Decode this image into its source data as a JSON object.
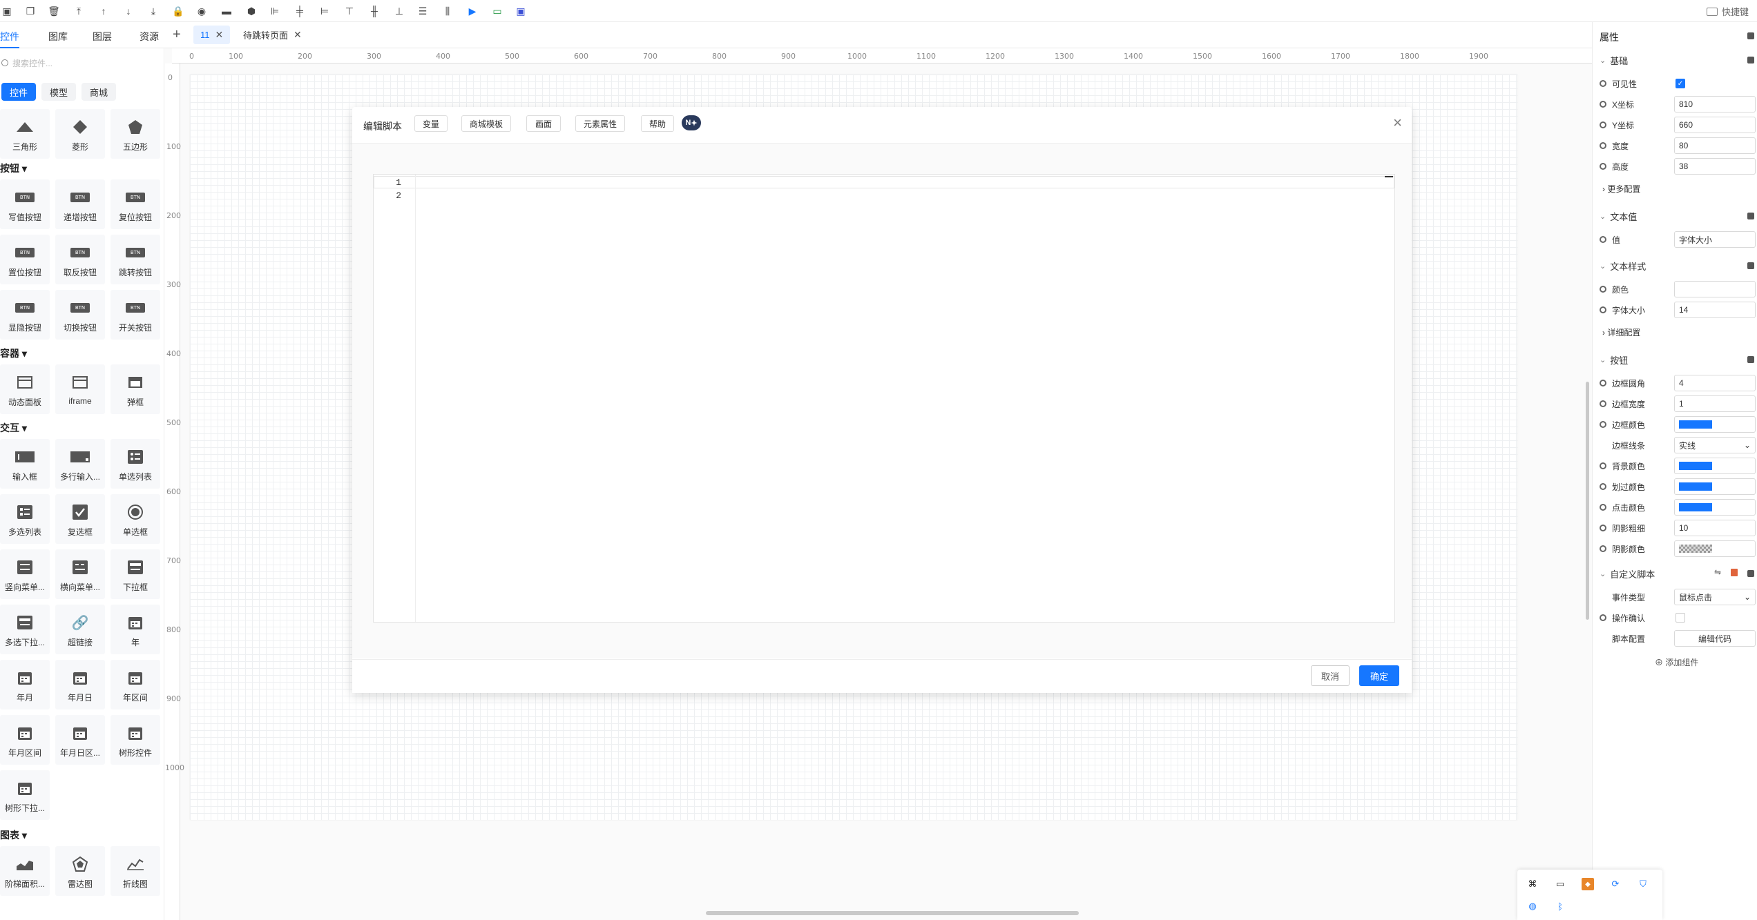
{
  "shortcut_label": "快捷键",
  "nav_tabs": [
    "控件",
    "图库",
    "图层",
    "资源"
  ],
  "page_tabs": [
    {
      "label": "11",
      "active": true
    },
    {
      "label": "待跳转页面",
      "active": false
    }
  ],
  "left": {
    "search_placeholder": "搜索控件...",
    "chips": [
      "控件",
      "模型",
      "商城"
    ],
    "shapes": [
      "三角形",
      "菱形",
      "五边形"
    ],
    "sec_buttons": "按钮",
    "buttons": [
      "写值按钮",
      "递增按钮",
      "复位按钮",
      "置位按钮",
      "取反按钮",
      "跳转按钮",
      "显隐按钮",
      "切换按钮",
      "开关按钮"
    ],
    "sec_container": "容器",
    "containers": [
      "动态面板",
      "iframe",
      "弹框"
    ],
    "sec_interact": "交互",
    "interacts": [
      "输入框",
      "多行输入...",
      "单选列表",
      "多选列表",
      "复选框",
      "单选框",
      "竖向菜单...",
      "横向菜单...",
      "下拉框",
      "多选下拉...",
      "超链接",
      "年",
      "年月",
      "年月日",
      "年区间",
      "年月区间",
      "年月日区...",
      "树形控件",
      "树形下拉..."
    ],
    "sec_chart": "图表",
    "charts": [
      "阶梯面积...",
      "雷达图",
      "折线图"
    ],
    "btn_glyph": "BTN"
  },
  "ruler": {
    "h": [
      "0",
      "100",
      "200",
      "300",
      "400",
      "500",
      "600",
      "700",
      "800",
      "900",
      "1000",
      "1100",
      "1200",
      "1300",
      "1400",
      "1500",
      "1600",
      "1700",
      "1800",
      "1900"
    ],
    "v": [
      "0",
      "100",
      "200",
      "300",
      "400",
      "500",
      "600",
      "700",
      "800",
      "900",
      "1000"
    ]
  },
  "modal": {
    "title": "编辑脚本",
    "tabs": [
      "变量",
      "商城模板",
      "画面",
      "元素属性",
      "帮助"
    ],
    "badge": "N",
    "line_numbers": [
      "1",
      "2"
    ],
    "cancel": "取消",
    "ok": "确定"
  },
  "props": {
    "title": "属性",
    "basic_group": "基础",
    "visible": "可见性",
    "x_label": "X坐标",
    "x_value": "810",
    "y_label": "Y坐标",
    "y_value": "660",
    "width_label": "宽度",
    "width_value": "80",
    "height_label": "高度",
    "height_value": "38",
    "more_config": "更多配置",
    "text_value_group": "文本值",
    "value_label": "值",
    "value_value": "字体大小",
    "text_style_group": "文本样式",
    "color_label": "颜色",
    "font_size_label": "字体大小",
    "font_size_value": "14",
    "detail_config": "详细配置",
    "button_group": "按钮",
    "radius_label": "边框圆角",
    "radius_value": "4",
    "border_width_label": "边框宽度",
    "border_width_value": "1",
    "border_color_label": "边框颜色",
    "border_style_label": "边框线条",
    "border_style_value": "实线",
    "bg_color_label": "背景颜色",
    "hover_color_label": "划过颜色",
    "click_color_label": "点击颜色",
    "shadow_size_label": "阴影粗细",
    "shadow_size_value": "10",
    "shadow_color_label": "阴影颜色",
    "script_group": "自定义脚本",
    "event_type_label": "事件类型",
    "event_type_value": "鼠标点击",
    "confirm_label": "操作确认",
    "script_config_label": "脚本配置",
    "edit_code": "编辑代码",
    "add_component": "添加组件"
  },
  "colors": {
    "accent": "#1677ff",
    "swatch": "#1677ff"
  }
}
